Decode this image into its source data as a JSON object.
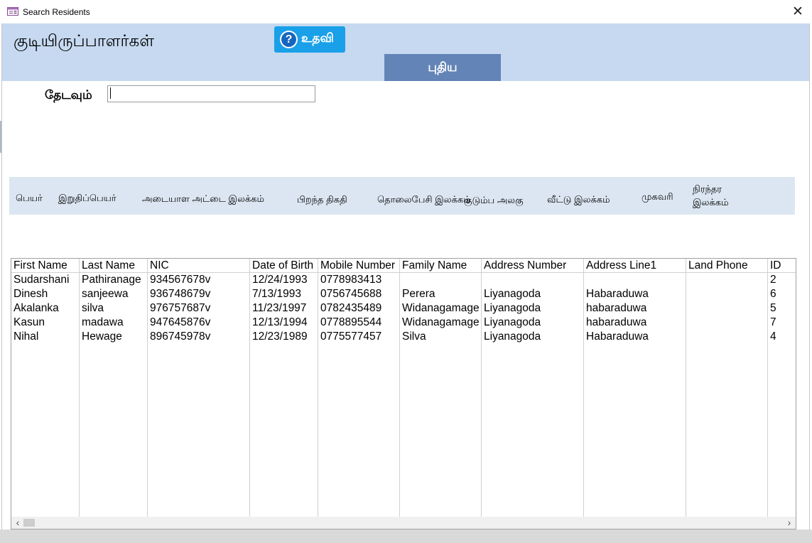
{
  "window": {
    "title": "Search Residents",
    "close_glyph": "✕",
    "icon": "form-icon"
  },
  "header": {
    "page_title": "குடியிருப்பாளர்கள்",
    "help_label": "உதவி",
    "help_icon_glyph": "?",
    "new_label": "புதிய",
    "background": "#c6d9f0",
    "help_button_color": "#1aa0e8",
    "new_button_color": "#6384b6"
  },
  "search": {
    "label": "தேடவும்",
    "value": "",
    "placeholder": ""
  },
  "tamil_headers": {
    "first_name": "பெயர்",
    "last_name": "இறுதிப்பெயர்",
    "nic": "அடையாள அட்டை இலக்கம்",
    "dob": "பிறந்த திகதி",
    "mobile": "தொலைபேசி இலக்கம்",
    "family": "குடும்ப அலகு",
    "house_no": "வீட்டு இலக்கம்",
    "address": "முகவரி",
    "permanent_line1": "நிரந்தர",
    "permanent_line2": "இலக்கம்"
  },
  "table": {
    "columns": [
      "First Name",
      "Last Name",
      "NIC",
      "Date of Birth",
      "Mobile Number",
      "Family Name",
      "Address Number",
      "Address Line1",
      "Land Phone",
      "ID"
    ],
    "rows": [
      [
        "Sudarshani",
        "Pathiranage",
        "934567678v",
        "12/24/1993",
        "0778983413",
        "",
        "",
        "",
        "",
        "2"
      ],
      [
        "Dinesh",
        "sanjeewa",
        "936748679v",
        "7/13/1993",
        "0756745688",
        "Perera",
        "Liyanagoda",
        "Habaraduwa",
        "",
        "6"
      ],
      [
        "Akalanka",
        "silva",
        "976757687v",
        "11/23/1997",
        "0782435489",
        "Widanagamage",
        "Liyanagoda",
        "habaraduwa",
        "",
        "5"
      ],
      [
        "Kasun",
        "madawa",
        "947645876v",
        "12/13/1994",
        "0778895544",
        "Widanagamage",
        "Liyanagoda",
        "habaraduwa",
        "",
        "7"
      ],
      [
        "Nihal",
        "Hewage",
        "896745978v",
        "12/23/1989",
        "0775577457",
        "Silva",
        "Liyanagoda",
        "Habaraduwa",
        "",
        "4"
      ]
    ]
  },
  "scrollbar": {
    "left_glyph": "‹",
    "right_glyph": "›"
  }
}
